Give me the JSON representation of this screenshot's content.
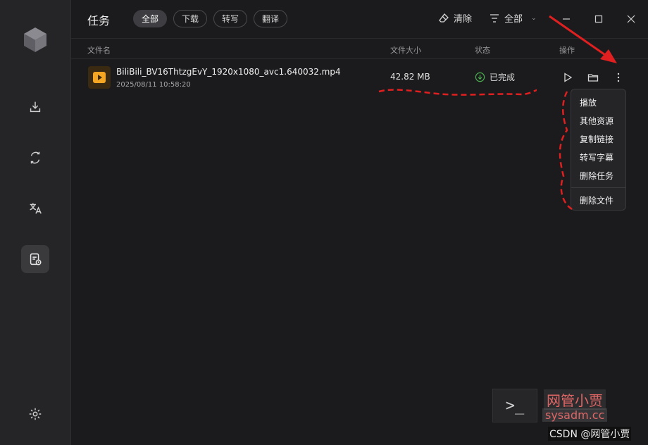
{
  "app": {
    "title": "任务"
  },
  "tabs": [
    {
      "label": "全部",
      "active": true
    },
    {
      "label": "下载",
      "active": false
    },
    {
      "label": "转写",
      "active": false
    },
    {
      "label": "翻译",
      "active": false
    }
  ],
  "toolbar": {
    "clear_label": "清除",
    "filter_label": "全部"
  },
  "columns": {
    "name": "文件名",
    "size": "文件大小",
    "status": "状态",
    "actions": "操作"
  },
  "task": {
    "name": "BiliBili_BV16ThtzgEvY_1920x1080_avc1.640032.mp4",
    "time": "2025/08/11 10:58:20",
    "size": "42.82 MB",
    "status": "已完成"
  },
  "menu": {
    "items": [
      "播放",
      "其他资源",
      "复制链接",
      "转写字幕",
      "删除任务"
    ],
    "danger_item": "删除文件"
  },
  "watermark": {
    "prompt_glyph": ">_",
    "line1": "网管小贾",
    "line2": "sysadm.cc",
    "line3": "CSDN @网管小贾"
  },
  "icons": {
    "sidebar": [
      "download-icon",
      "convert-icon",
      "translate-icon",
      "tasks-icon",
      "settings-icon"
    ],
    "row_actions": [
      "play-icon",
      "folder-icon",
      "more-icon"
    ]
  },
  "colors": {
    "accent_red": "#e02020",
    "status_green": "#4caf50",
    "file_icon_orange": "#f5a623"
  }
}
